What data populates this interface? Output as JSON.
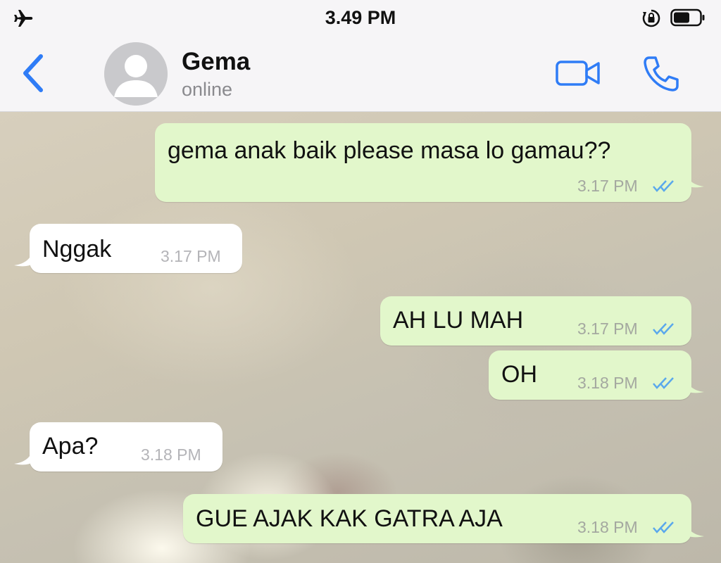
{
  "status_bar": {
    "time": "3.49 PM",
    "icons": [
      "airplane-mode-icon",
      "rotation-lock-icon",
      "battery-icon"
    ]
  },
  "header": {
    "contact_name": "Gema",
    "contact_status": "online",
    "icons": [
      "back-chevron-icon",
      "avatar-placeholder-icon",
      "video-camera-icon",
      "phone-icon"
    ]
  },
  "colors": {
    "accent": "#2f7cf6",
    "outgoing_bubble": "#e2f7cb",
    "incoming_bubble": "#ffffff",
    "read_receipt": "#5aa8ec"
  },
  "messages": [
    {
      "direction": "outgoing",
      "text": "gema anak baik please masa lo gamau??",
      "time": "3.17 PM",
      "read": true
    },
    {
      "direction": "incoming",
      "text": "Nggak",
      "time": "3.17 PM"
    },
    {
      "direction": "outgoing",
      "text": "AH LU MAH",
      "time": "3.17 PM",
      "read": true
    },
    {
      "direction": "outgoing",
      "text": "OH",
      "time": "3.18 PM",
      "read": true
    },
    {
      "direction": "incoming",
      "text": "Apa?",
      "time": "3.18 PM"
    },
    {
      "direction": "outgoing",
      "text": "GUE AJAK KAK GATRA AJA",
      "time": "3.18 PM",
      "read": true
    }
  ]
}
